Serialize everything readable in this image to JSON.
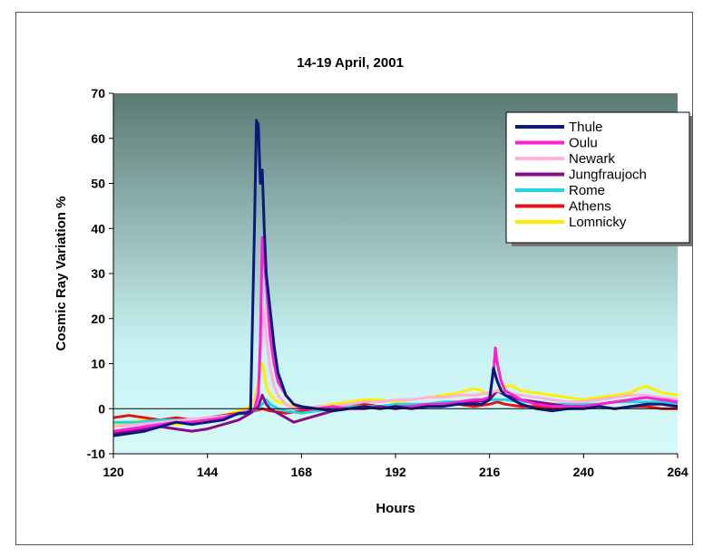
{
  "chart_data": {
    "type": "line",
    "title": "14-19 April, 2001",
    "xlabel": "Hours",
    "ylabel": "Cosmic Ray Variation %",
    "xlim": [
      120,
      264
    ],
    "ylim": [
      -10,
      70
    ],
    "xticks": [
      120,
      144,
      168,
      192,
      216,
      240,
      264
    ],
    "yticks": [
      -10,
      0,
      10,
      20,
      30,
      40,
      50,
      60,
      70
    ],
    "legend_position": "top-right",
    "background_gradient": [
      "#5a7a74",
      "#c8f2f2",
      "#d6fafa"
    ],
    "series": [
      {
        "name": "Thule",
        "color": "#0a1a7a",
        "x": [
          120,
          124,
          128,
          132,
          136,
          140,
          144,
          148,
          152,
          154,
          155,
          156,
          156.5,
          157,
          157.5,
          158,
          158.5,
          159,
          160,
          161,
          162,
          164,
          166,
          168,
          172,
          176,
          180,
          184,
          188,
          192,
          196,
          200,
          204,
          208,
          212,
          214,
          216,
          217,
          218,
          219,
          220,
          222,
          224,
          226,
          228,
          232,
          236,
          240,
          244,
          248,
          252,
          256,
          260,
          264
        ],
        "y": [
          -6,
          -5.5,
          -5,
          -4,
          -3,
          -3.5,
          -3,
          -2.5,
          -1,
          -1,
          -0.5,
          40,
          64,
          63,
          50,
          53,
          40,
          30,
          22,
          14,
          8,
          3,
          1,
          0.5,
          0,
          -0.5,
          0,
          0.5,
          0,
          0.5,
          0,
          0.5,
          0.5,
          1,
          1,
          1,
          2,
          9,
          6,
          4,
          3,
          2,
          1,
          0.5,
          0,
          -0.5,
          0,
          0,
          0.5,
          0,
          0.5,
          1,
          1,
          0.5
        ]
      },
      {
        "name": "Oulu",
        "color": "#ff1fd2",
        "x": [
          120,
          124,
          128,
          132,
          136,
          140,
          144,
          148,
          152,
          155,
          156,
          157,
          157.5,
          158,
          158.5,
          159,
          159.5,
          160,
          161,
          162,
          164,
          166,
          168,
          172,
          176,
          180,
          184,
          188,
          192,
          196,
          200,
          204,
          208,
          212,
          214,
          216,
          217,
          217.5,
          218,
          219,
          220,
          222,
          224,
          228,
          232,
          236,
          240,
          244,
          248,
          252,
          256,
          260,
          264
        ],
        "y": [
          -5,
          -4.5,
          -4,
          -3.5,
          -3,
          -3,
          -2.5,
          -2,
          -1,
          -0.5,
          0,
          3,
          15,
          38,
          33,
          28,
          22,
          16,
          10,
          6,
          3,
          1,
          0,
          0,
          0.5,
          0,
          0.5,
          0,
          0.5,
          0.5,
          1,
          1,
          1.5,
          2,
          2,
          2.5,
          8,
          13.5,
          10,
          6,
          4,
          3,
          2,
          1,
          0.5,
          0.5,
          0.5,
          1,
          1.5,
          2,
          2.5,
          2,
          1.5
        ]
      },
      {
        "name": "Newark",
        "color": "#ffb0dc",
        "x": [
          120,
          126,
          132,
          138,
          144,
          150,
          154,
          156,
          157,
          158,
          158.5,
          159,
          160,
          161,
          162,
          164,
          166,
          168,
          172,
          176,
          180,
          184,
          188,
          192,
          196,
          200,
          204,
          208,
          212,
          216,
          218,
          220,
          224,
          228,
          232,
          236,
          240,
          244,
          248,
          252,
          256,
          260,
          264
        ],
        "y": [
          -4,
          -3.5,
          -3,
          -2.5,
          -2,
          -1.5,
          -0.5,
          0,
          5,
          18,
          22,
          16,
          9,
          5,
          3,
          1,
          0,
          0,
          0.5,
          0.5,
          1,
          1.5,
          1.5,
          2,
          2,
          2.5,
          2.5,
          3,
          3,
          3.5,
          4,
          3.5,
          3,
          2.5,
          2,
          1.5,
          1.5,
          2,
          2.5,
          3,
          3,
          2.5,
          2
        ]
      },
      {
        "name": "Jungfraujoch",
        "color": "#8a0a8a",
        "x": [
          120,
          124,
          128,
          132,
          136,
          140,
          144,
          148,
          152,
          155,
          157,
          158,
          158.5,
          159,
          160,
          162,
          164,
          166,
          168,
          172,
          176,
          180,
          184,
          188,
          192,
          196,
          200,
          204,
          208,
          212,
          216,
          218,
          220,
          224,
          228,
          232,
          236,
          240,
          244,
          248,
          252,
          256,
          260,
          264
        ],
        "y": [
          -5.5,
          -5,
          -4.5,
          -4,
          -4.5,
          -5,
          -4.5,
          -3.5,
          -2.5,
          -1,
          0.5,
          3,
          2,
          1,
          0,
          -1,
          -2,
          -3,
          -2.5,
          -1.5,
          -0.5,
          0,
          0,
          0.5,
          0,
          0.5,
          0.5,
          1,
          1,
          1.5,
          2,
          4,
          3,
          2,
          1.5,
          1,
          0.5,
          0.5,
          1,
          1.5,
          2,
          2.5,
          2,
          1.5
        ]
      },
      {
        "name": "Rome",
        "color": "#22d4dc",
        "x": [
          120,
          126,
          132,
          138,
          144,
          150,
          154,
          156,
          158,
          159,
          160,
          162,
          164,
          168,
          172,
          176,
          180,
          184,
          188,
          192,
          196,
          200,
          204,
          208,
          212,
          216,
          220,
          224,
          228,
          232,
          236,
          240,
          244,
          248,
          252,
          256,
          260,
          264
        ],
        "y": [
          -3,
          -3,
          -2.5,
          -2.5,
          -2,
          -1.5,
          -1,
          -0.5,
          1,
          2,
          1,
          0,
          -0.5,
          -1,
          -0.5,
          0,
          0.5,
          0.5,
          0.5,
          1,
          1,
          1,
          1.5,
          1.5,
          1.5,
          2,
          2,
          1.5,
          1.5,
          1,
          1,
          1,
          1,
          1.5,
          1.5,
          1.5,
          1.5,
          1
        ]
      },
      {
        "name": "Athens",
        "color": "#e81010",
        "x": [
          120,
          124,
          128,
          132,
          136,
          140,
          144,
          148,
          152,
          156,
          158,
          160,
          164,
          168,
          172,
          176,
          180,
          184,
          188,
          192,
          196,
          200,
          204,
          208,
          212,
          216,
          218,
          220,
          224,
          228,
          232,
          236,
          240,
          244,
          248,
          252,
          256,
          260,
          264
        ],
        "y": [
          -2,
          -1.5,
          -2,
          -2.5,
          -2,
          -2.5,
          -2,
          -1.5,
          -1,
          -0.5,
          0,
          -0.5,
          -1,
          -0.5,
          0,
          0.5,
          0.5,
          1,
          0.5,
          0,
          0.5,
          0.5,
          1,
          1,
          0.5,
          1,
          1.5,
          1,
          0.5,
          0.5,
          0,
          0,
          0.5,
          0.5,
          0,
          0.5,
          0.5,
          0,
          0
        ]
      },
      {
        "name": "Lomnicky",
        "color": "#ffee00",
        "x": [
          120,
          124,
          128,
          132,
          136,
          140,
          144,
          148,
          152,
          155,
          156,
          157,
          157.5,
          158,
          158.5,
          159,
          160,
          162,
          164,
          166,
          168,
          172,
          176,
          180,
          184,
          188,
          192,
          196,
          200,
          204,
          208,
          212,
          214,
          216,
          218,
          220,
          222,
          224,
          228,
          232,
          236,
          240,
          244,
          248,
          252,
          254,
          256,
          260,
          264
        ],
        "y": [
          -3.5,
          -3,
          -2.5,
          -3,
          -3.5,
          -3,
          -2.5,
          -1.5,
          -0.5,
          0.5,
          2,
          6,
          9,
          10,
          8,
          5,
          3,
          1.5,
          1,
          0.5,
          0,
          0.5,
          1,
          1.5,
          2,
          2,
          1.5,
          2,
          2.5,
          3,
          3.5,
          4.5,
          4,
          3,
          4,
          5,
          5,
          4,
          3.5,
          3,
          2.5,
          2,
          2.5,
          3,
          3.5,
          4.5,
          5,
          3.5,
          3
        ]
      }
    ]
  }
}
